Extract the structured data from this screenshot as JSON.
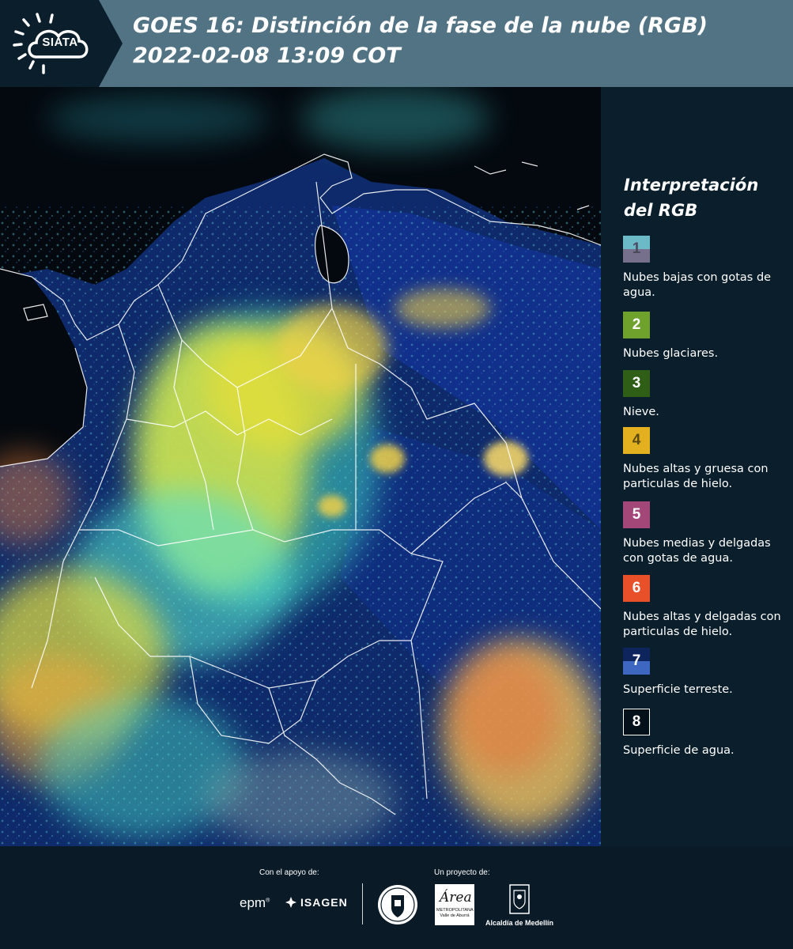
{
  "header": {
    "logo_text": "SIATA",
    "title_line1": "GOES 16: Distinción de la fase de la nube (RGB)",
    "title_line2": " 2022-02-08 13:09 COT"
  },
  "legend": {
    "title": "Interpretación del RGB",
    "items": [
      {
        "number": "1",
        "label": "Nubes bajas con gotas de agua.",
        "colors": [
          "#6cb9c7",
          "#77708c"
        ]
      },
      {
        "number": "2",
        "label": "Nubes glaciares.",
        "colors": [
          "#6fa12d"
        ]
      },
      {
        "number": "3",
        "label": "Nieve.",
        "colors": [
          "#2f5e17"
        ]
      },
      {
        "number": "4",
        "label": "Nubes altas y gruesa con particulas de hielo.",
        "colors": [
          "#e3b11f"
        ]
      },
      {
        "number": "5",
        "label": "Nubes medias y delgadas con gotas de agua.",
        "colors": [
          "#a34678"
        ]
      },
      {
        "number": "6",
        "label": "Nubes altas y delgadas con particulas de hielo.",
        "colors": [
          "#e8502a"
        ]
      },
      {
        "number": "7",
        "label": "Superficie terreste.",
        "colors": [
          "#0e245c",
          "#3d67c0"
        ]
      },
      {
        "number": "8",
        "label": "Superficie de agua.",
        "colors": [
          "#04101a"
        ]
      }
    ]
  },
  "footer": {
    "support_label": "Con el apoyo de:",
    "project_label": "Un proyecto de:",
    "sponsors": [
      "epm",
      "ISAGEN"
    ],
    "partners": [
      "Área Metropolitana Valle de Aburrá",
      "Alcaldía de Medellín"
    ],
    "area_logo_text": "Área",
    "area_logo_sub": "METROPOLITANA Valle de Aburrá",
    "medellin_label": "Alcaldía de Medellín"
  }
}
